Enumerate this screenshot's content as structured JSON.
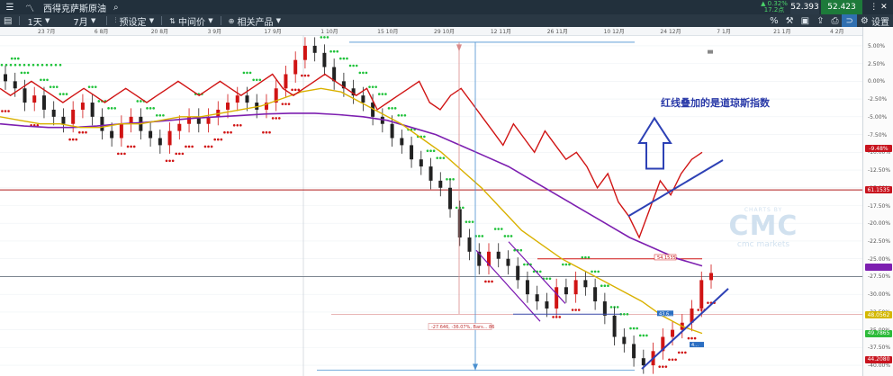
{
  "toolbar": {
    "instrument": "西得克萨斯原油",
    "timeframe": "1天",
    "range": "7月",
    "preset_label": "预设定",
    "price_label": "中间价",
    "related_label": "相关产品",
    "change_pct": "▲ 0.32%",
    "change_abs": "17.2点",
    "sell_price": "52.393",
    "buy_price": "52.423",
    "settings_label": "设置"
  },
  "x_axis": [
    "23 7月",
    "6 8月",
    "20 8月",
    "3 9月",
    "17 9月",
    "1 10月",
    "15 10月",
    "29 10月",
    "12 11月",
    "26 11月",
    "10 12月",
    "24 12月",
    "7 1月",
    "21 1月",
    "4 2月"
  ],
  "y_axis": [
    "5.00%",
    "2.50%",
    "0.00%",
    "-2.50%",
    "-5.00%",
    "-7.50%",
    "-10.00%",
    "-12.50%",
    "-15.00%",
    "-17.50%",
    "-20.00%",
    "-22.50%",
    "-25.00%",
    "-27.50%",
    "-30.00%",
    "-32.50%",
    "-35.00%",
    "-37.50%",
    "-40.00%"
  ],
  "y_labels": [
    {
      "text": "-9.48%",
      "color": "#c8141e"
    },
    {
      "text": "61.1535",
      "color": "#c8141e"
    },
    {
      "text": "48.0562",
      "color": "#d4b800"
    },
    {
      "text": "49.7865",
      "color": "#2dbb3a"
    },
    {
      "text": "44.2080",
      "color": "#c8141e"
    }
  ],
  "annotations": {
    "note": "红线叠加的是道琼斯指数",
    "line_label": "54.1535",
    "measure_label": "-27.646, -36.07%, Bars... 86",
    "small_label_1": "43.6...",
    "small_label_2": "4..."
  },
  "watermark": {
    "top": "CHARTS BY",
    "logo": "CMC",
    "bottom": "cmc markets"
  },
  "chart_data": {
    "type": "candlestick",
    "x_ticks": [
      "23 7月",
      "6 8月",
      "20 8月",
      "3 9月",
      "17 9月",
      "1 10月",
      "15 10月",
      "29 10月",
      "12 11月",
      "26 11月",
      "10 12月",
      "24 12月",
      "7 1月",
      "21 1月",
      "4 2月"
    ],
    "ylim": [
      -41,
      6
    ],
    "close_pct": [
      0,
      -1,
      -3,
      -2,
      -4,
      -5,
      -6,
      -4,
      -3,
      -5,
      -7,
      -8,
      -6,
      -5,
      -7,
      -8,
      -9,
      -7,
      -6,
      -5,
      -6,
      -5,
      -4,
      -3,
      -2,
      -3,
      -4,
      -3,
      -1,
      1,
      3,
      5,
      4,
      2,
      0,
      -1,
      -2,
      -3,
      -5,
      -6,
      -8,
      -9,
      -11,
      -12,
      -14,
      -15,
      -18,
      -22,
      -24,
      -26,
      -24,
      -25,
      -26,
      -28,
      -30,
      -31,
      -32,
      -29,
      -30,
      -28,
      -29,
      -31,
      -33,
      -36,
      -37,
      -39,
      -40,
      -38,
      -36,
      -35,
      -34,
      -32,
      -28,
      -27
    ],
    "dow_pct": [
      -1,
      -2,
      -1,
      0,
      -1,
      -2,
      -3,
      -2,
      -1,
      -2,
      -3,
      -2,
      -1,
      -2,
      -3,
      -2,
      -1,
      0,
      -1,
      -2,
      -1,
      0,
      -1,
      -2,
      -1,
      0,
      1,
      -1,
      -2,
      -1,
      0,
      1,
      0,
      -1,
      -2,
      -1,
      -4,
      -3,
      -2,
      -1,
      0,
      -3,
      -4,
      -2,
      -1,
      -3,
      -5,
      -7,
      -9,
      -6,
      -8,
      -10,
      -7,
      -9,
      -11,
      -10,
      -12,
      -15,
      -13,
      -17,
      -19,
      -22,
      -18,
      -14,
      -16,
      -13,
      -11,
      -10
    ],
    "ma_yellow_pct": [
      -5,
      -5.5,
      -6,
      -6,
      -6.5,
      -6.5,
      -6,
      -6,
      -5.5,
      -5,
      -5,
      -4.5,
      -4,
      -3.5,
      -2.5,
      -1.5,
      -1,
      -1.5,
      -3,
      -4.5,
      -6,
      -8,
      -10,
      -12.5,
      -15,
      -18,
      -21,
      -23,
      -25,
      -26.5,
      -28,
      -29.5,
      -31,
      -33,
      -34.5,
      -35.5
    ],
    "ma_purple_pct": [
      -6,
      -6.3,
      -6.5,
      -6.5,
      -6.3,
      -6,
      -5.8,
      -5.5,
      -5.2,
      -5,
      -4.8,
      -4.6,
      -4.5,
      -4.5,
      -4.7,
      -5,
      -5.5,
      -6.5,
      -7.5,
      -9,
      -10.5,
      -12,
      -14,
      -16,
      -18,
      -20,
      -22,
      -23.5,
      -25,
      -26
    ],
    "horizontal_lines": [
      {
        "label": "61.1535",
        "pct": -15.3
      },
      {
        "label": "54.1535",
        "pct": -25.0
      },
      {
        "label": "price",
        "pct": -27.5
      }
    ]
  }
}
